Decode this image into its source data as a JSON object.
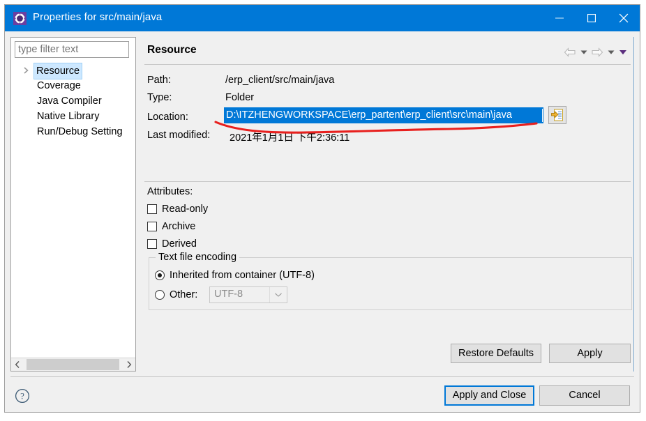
{
  "window": {
    "title": "Properties for src/main/java",
    "icon": "gear-icon",
    "minimize_label": "Minimize",
    "maximize_label": "Maximize",
    "close_label": "Close"
  },
  "sidebar": {
    "filter_placeholder": "type filter text",
    "filter_value": "",
    "items": [
      {
        "label": "Resource",
        "selected": true,
        "expandable": true
      },
      {
        "label": "Coverage",
        "selected": false,
        "expandable": false
      },
      {
        "label": "Java Compiler",
        "selected": false,
        "expandable": false
      },
      {
        "label": "Native Library",
        "selected": false,
        "expandable": false
      },
      {
        "label": "Run/Debug Setting",
        "selected": false,
        "expandable": false
      }
    ],
    "scroll_left_icon": "chevron-left-icon",
    "scroll_right_icon": "chevron-right-icon"
  },
  "page": {
    "title": "Resource",
    "nav": {
      "back_icon": "arrow-left-icon",
      "back_menu_icon": "caret-down-icon",
      "forward_icon": "arrow-right-icon",
      "forward_menu_icon": "caret-down-icon",
      "view_menu_icon": "caret-down-purple-icon"
    },
    "fields": [
      {
        "label": "Path:",
        "value": "/erp_client/src/main/java"
      },
      {
        "label": "Type:",
        "value": "Folder"
      }
    ],
    "location": {
      "label": "Location:",
      "value": "D:\\ITZHENGWORKSPACE\\erp_partent\\erp_client\\src\\main\\java",
      "selected": true,
      "browse_icon": "open-folder-icon",
      "selection_color": "#0078d7"
    },
    "last_modified": {
      "label": "Last modified:",
      "value": "2021年1月1日 下午2:36:11"
    },
    "attributes": {
      "title": "Attributes:",
      "items": [
        {
          "label": "Read-only",
          "checked": false
        },
        {
          "label": "Archive",
          "checked": false
        },
        {
          "label": "Derived",
          "checked": false
        }
      ]
    },
    "encoding": {
      "legend": "Text file encoding",
      "inherited_label": "Inherited from container (UTF-8)",
      "inherited_selected": true,
      "other_label": "Other:",
      "other_selected": false,
      "other_value": "UTF-8",
      "dropdown_icon": "chevron-down-icon"
    },
    "buttons": {
      "restore_defaults": "Restore Defaults",
      "apply": "Apply"
    }
  },
  "footer": {
    "help_icon": "help-question-icon",
    "apply_and_close": "Apply and Close",
    "cancel": "Cancel",
    "focused_button": "Apply and Close"
  },
  "annotation": {
    "type": "hand-drawn-underline",
    "color": "#e8201e",
    "target": "location-field"
  }
}
